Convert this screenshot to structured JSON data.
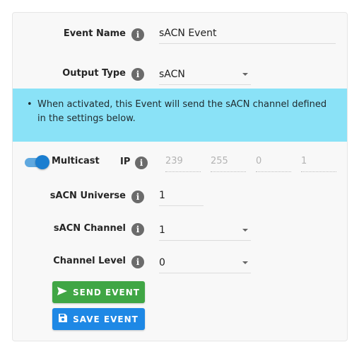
{
  "form": {
    "event_name": {
      "label": "Event Name",
      "value": "sACN Event"
    },
    "output_type": {
      "label": "Output Type",
      "value": "sACN"
    },
    "alert": {
      "text": "When activated, this Event will send the sACN channel defined in the settings below."
    },
    "multicast": {
      "label": "Multicast",
      "enabled": true
    },
    "ip": {
      "label": "IP",
      "octets": [
        "239",
        "255",
        "0",
        "1"
      ]
    },
    "universe": {
      "label": "sACN Universe",
      "value": "1"
    },
    "channel": {
      "label": "sACN Channel",
      "value": "1"
    },
    "level": {
      "label": "Channel Level",
      "value": "0"
    }
  },
  "buttons": {
    "send": "SEND EVENT",
    "save": "SAVE EVENT"
  },
  "icons": {
    "info": "info-icon",
    "send": "send-arrow-icon",
    "save": "floppy-disk-icon",
    "caret": "chevron-down-icon"
  },
  "colors": {
    "alert_bg": "#8ae2f7",
    "toggle": "#1b7ed0",
    "send_button": "#40a645",
    "save_button": "#1e88e5"
  }
}
